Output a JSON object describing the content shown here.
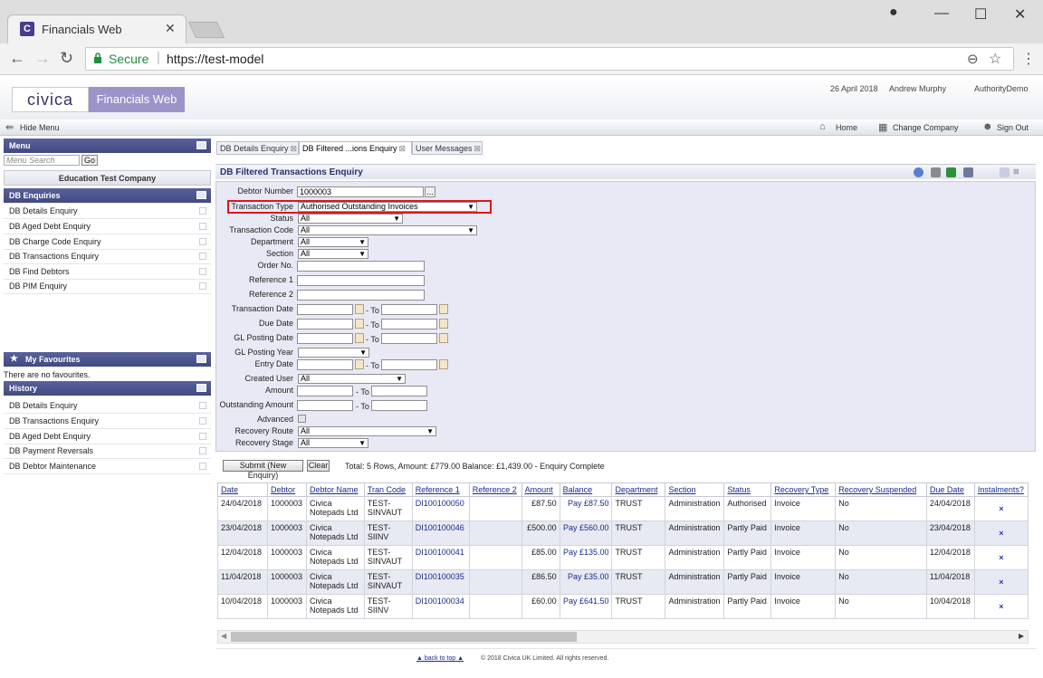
{
  "browser": {
    "tab_title": "Financials Web",
    "favicon_letter": "C",
    "secure_label": "Secure",
    "url": "https://test-model"
  },
  "app": {
    "logo_text": "civica",
    "product_name": "Financials Web",
    "date": "26 April 2018",
    "user": "Andrew Murphy",
    "authority": "AuthorityDemo",
    "hide_menu": "Hide Menu",
    "nav": {
      "home": "Home",
      "change_company": "Change Company",
      "sign_out": "Sign Out"
    }
  },
  "sidebar": {
    "menu_title": "Menu",
    "search_placeholder": "Menu Search",
    "go_label": "Go",
    "company": "Education Test Company",
    "enquiries_title": "DB Enquiries",
    "enquiries": [
      "DB Details Enquiry",
      "DB Aged Debt Enquiry",
      "DB Charge Code Enquiry",
      "DB Transactions Enquiry",
      "DB Find Debtors",
      "DB PIM Enquiry"
    ],
    "favourites_title": "My Favourites",
    "favourites_empty": "There are no favourites.",
    "history_title": "History",
    "history": [
      "DB Details Enquiry",
      "DB Transactions Enquiry",
      "DB Aged Debt Enquiry",
      "DB Payment Reversals",
      "DB Debtor Maintenance"
    ]
  },
  "tabs": [
    {
      "label": "DB Details Enquiry"
    },
    {
      "label": "DB Filtered ...ions Enquiry"
    },
    {
      "label": "User Messages"
    }
  ],
  "panel_title": "DB Filtered Transactions Enquiry",
  "form": {
    "debtor_number": {
      "label": "Debtor Number",
      "value": "1000003"
    },
    "transaction_type": {
      "label": "Transaction Type",
      "value": "Authorised Outstanding Invoices"
    },
    "status": {
      "label": "Status",
      "value": "All"
    },
    "transaction_code": {
      "label": "Transaction Code",
      "value": "All"
    },
    "department": {
      "label": "Department",
      "value": "All"
    },
    "section": {
      "label": "Section",
      "value": "All"
    },
    "order_no": {
      "label": "Order No."
    },
    "reference1": {
      "label": "Reference 1"
    },
    "reference2": {
      "label": "Reference 2"
    },
    "transaction_date": {
      "label": "Transaction Date"
    },
    "due_date": {
      "label": "Due Date"
    },
    "gl_posting_date": {
      "label": "GL Posting Date"
    },
    "gl_posting_year": {
      "label": "GL Posting Year",
      "value": ""
    },
    "entry_date": {
      "label": "Entry Date"
    },
    "created_user": {
      "label": "Created User",
      "value": "All"
    },
    "amount": {
      "label": "Amount"
    },
    "outstanding_amount": {
      "label": "Outstanding Amount"
    },
    "advanced": {
      "label": "Advanced"
    },
    "recovery_route": {
      "label": "Recovery Route",
      "value": "All"
    },
    "recovery_stage": {
      "label": "Recovery Stage",
      "value": "All"
    },
    "to_label": "- To"
  },
  "actions": {
    "submit": "Submit (New Enquiry)",
    "clear": "Clear",
    "status": "Total: 5 Rows, Amount: £779.00 Balance: £1,439.00 - Enquiry Complete"
  },
  "results": {
    "headers": [
      "Date",
      "Debtor",
      "Debtor Name",
      "Tran Code",
      "Reference 1",
      "Reference 2",
      "Amount",
      "Balance",
      "Department",
      "Section",
      "Status",
      "Recovery Type",
      "Recovery Suspended",
      "Due Date",
      "Instalments?"
    ],
    "rows": [
      [
        "24/04/2018",
        "1000003",
        "Civica Notepads Ltd",
        "TEST-SINVAUT",
        "DI100100050",
        "",
        "£87.50",
        "Pay £87.50",
        "TRUST",
        "Administration",
        "Authorised",
        "Invoice",
        "No",
        "24/04/2018",
        "×"
      ],
      [
        "23/04/2018",
        "1000003",
        "Civica Notepads Ltd",
        "TEST-SIINV",
        "DI100100046",
        "",
        "£500.00",
        "Pay £560.00",
        "TRUST",
        "Administration",
        "Partly Paid",
        "Invoice",
        "No",
        "23/04/2018",
        "×"
      ],
      [
        "12/04/2018",
        "1000003",
        "Civica Notepads Ltd",
        "TEST-SINVAUT",
        "DI100100041",
        "",
        "£85.00",
        "Pay £135.00",
        "TRUST",
        "Administration",
        "Partly Paid",
        "Invoice",
        "No",
        "12/04/2018",
        "×"
      ],
      [
        "11/04/2018",
        "1000003",
        "Civica Notepads Ltd",
        "TEST-SINVAUT",
        "DI100100035",
        "",
        "£86.50",
        "Pay £35.00",
        "TRUST",
        "Administration",
        "Partly Paid",
        "Invoice",
        "No",
        "11/04/2018",
        "×"
      ],
      [
        "10/04/2018",
        "1000003",
        "Civica Notepads Ltd",
        "TEST-SIINV",
        "DI100100034",
        "",
        "£60.00",
        "Pay £641.50",
        "TRUST",
        "Administration",
        "Partly Paid",
        "Invoice",
        "No",
        "10/04/2018",
        "×"
      ]
    ]
  },
  "footer": {
    "back_to_top": "back to top",
    "copyright": "© 2018 Civica UK Limited. All rights reserved."
  }
}
